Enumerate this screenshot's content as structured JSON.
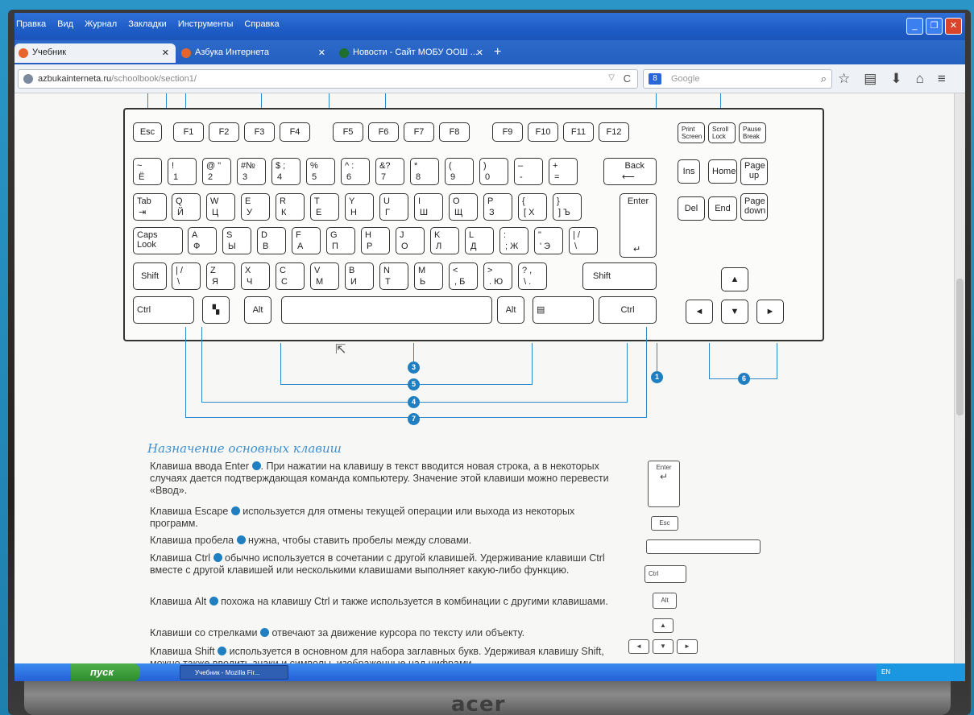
{
  "menu": [
    "Правка",
    "Вид",
    "Журнал",
    "Закладки",
    "Инструменты",
    "Справка"
  ],
  "tabs": [
    {
      "label": "Учебник"
    },
    {
      "label": "Азбука Интернета"
    },
    {
      "label": "Новости - Сайт МОБУ ООШ ..."
    }
  ],
  "url": {
    "host": "azbukainterneta.ru",
    "path": "/schoolbook/section1/"
  },
  "search": {
    "placeholder": "Google",
    "engine": "8"
  },
  "keys": {
    "esc": "Esc",
    "f1": "F1",
    "f2": "F2",
    "f3": "F3",
    "f4": "F4",
    "f5": "F5",
    "f6": "F6",
    "f7": "F7",
    "f8": "F8",
    "f9": "F9",
    "f10": "F10",
    "f11": "F11",
    "f12": "F12",
    "prtsc": "Print Screen",
    "scroll": "Scroll Lock",
    "pause": "Pause Break",
    "back": "Back",
    "tab": "Tab",
    "enter": "Enter",
    "caps": "Caps Look",
    "shift": "Shift",
    "ctrl": "Ctrl",
    "alt": "Alt",
    "ins": "Ins",
    "home": "Home",
    "pageup": "Page up",
    "del": "Del",
    "end": "End",
    "pagedown": "Page down"
  },
  "row1": [
    [
      "~",
      "Ё"
    ],
    [
      "!",
      "1"
    ],
    [
      "@ \"",
      "2"
    ],
    [
      "#№",
      "3"
    ],
    [
      "$ ;",
      "4"
    ],
    [
      "%",
      "5"
    ],
    [
      "^ :",
      "6"
    ],
    [
      "&?",
      "7"
    ],
    [
      "*",
      "8"
    ],
    [
      "(",
      "9"
    ],
    [
      ")",
      "0"
    ],
    [
      "–",
      "-"
    ],
    [
      "+",
      "="
    ]
  ],
  "row2": [
    [
      "Q",
      "Й"
    ],
    [
      "W",
      "Ц"
    ],
    [
      "E",
      "У"
    ],
    [
      "R",
      "К"
    ],
    [
      "T",
      "Е"
    ],
    [
      "Y",
      "Н"
    ],
    [
      "U",
      "Г"
    ],
    [
      "I",
      "Ш"
    ],
    [
      "O",
      "Щ"
    ],
    [
      "P",
      "З"
    ],
    [
      "{",
      "[ Х"
    ],
    [
      "}",
      "] Ъ"
    ]
  ],
  "row3": [
    [
      "A",
      "Ф"
    ],
    [
      "S",
      "Ы"
    ],
    [
      "D",
      "В"
    ],
    [
      "F",
      "А"
    ],
    [
      "G",
      "П"
    ],
    [
      "H",
      "Р"
    ],
    [
      "J",
      "О"
    ],
    [
      "K",
      "Л"
    ],
    [
      "L",
      "Д"
    ],
    [
      ":",
      "; Ж"
    ],
    [
      "\"",
      "' Э"
    ],
    [
      "| /",
      "\\"
    ]
  ],
  "row4": [
    [
      "| /",
      "\\"
    ],
    [
      "Z",
      "Я"
    ],
    [
      "X",
      "Ч"
    ],
    [
      "C",
      "С"
    ],
    [
      "V",
      "М"
    ],
    [
      "B",
      "И"
    ],
    [
      "N",
      "Т"
    ],
    [
      "M",
      "Ь"
    ],
    [
      "<",
      ", Б"
    ],
    [
      ">",
      ". Ю"
    ],
    [
      "? ,",
      "\\ ."
    ]
  ],
  "callouts": [
    "3",
    "5",
    "4",
    "7",
    "1",
    "6"
  ],
  "section_title": "Назначение основных клавиш",
  "paragraphs": [
    {
      "text_before": "Клавиша ввода Enter",
      "text_after": ". При нажатии на клавишу в текст вводится новая строка, а в некоторых случаях дается подтверждающая команда компьютеру. Значение этой клавиши можно перевести «Ввод».",
      "icon": "Enter"
    },
    {
      "text_before": "Клавиша Escape",
      "text_after": " используется для отмены текущей операции или выхода из некоторых программ.",
      "icon": "Esc"
    },
    {
      "text_before": "Клавиша пробела",
      "text_after": " нужна, чтобы ставить пробелы между словами.",
      "icon": ""
    },
    {
      "text_before": "Клавиша Ctrl",
      "text_after": " обычно используется в сочетании с другой клавишей. Удерживание клавиши Ctrl вместе с другой клавишей или несколькими клавишами выполняет какую-либо функцию.",
      "icon": "Ctrl"
    },
    {
      "text_before": "Клавиша Alt",
      "text_after": " похожа на клавишу Ctrl и также используется в комбинации с другими клавишами.",
      "icon": "Alt"
    },
    {
      "text_before": "Клавиши со стрелками",
      "text_after": " отвечают за движение курсора по тексту или объекту.",
      "icon": ""
    },
    {
      "text_before": "Клавиша Shift",
      "text_after": " используется в основном для набора заглавных букв. Удерживая клавишу Shift, можно также вводить знаки и символы, изображенные над цифрами",
      "icon": ""
    }
  ],
  "taskbar": {
    "start": "пуск",
    "task": "Учебник - Mozilla Fir...",
    "lang": "EN"
  },
  "brand": "acer"
}
